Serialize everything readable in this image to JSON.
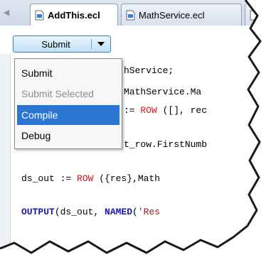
{
  "tabs": [
    {
      "label": "AddThis.ecl",
      "active": true,
      "icon": "ecl-file-icon"
    },
    {
      "label": "MathService.ecl",
      "active": false,
      "icon": "ecl-file-icon"
    }
  ],
  "toolbar": {
    "submit_label": "Submit",
    "dropdown_icon": "chevron-down-icon"
  },
  "menu": {
    "items": [
      {
        "label": "Submit",
        "state": "normal"
      },
      {
        "label": "Submit Selected",
        "state": "disabled"
      },
      {
        "label": "Compile",
        "state": "highlighted"
      },
      {
        "label": "Debug",
        "state": "normal"
      }
    ]
  },
  "code": {
    "line1_text": "hService;",
    "line2_text": "MathService.Ma",
    "line3_op": ":= ",
    "line3_fn": "ROW",
    "line3_rest": " ([], rec",
    "line4_text": "t_row.FirstNumb",
    "line5_var": "ds_out := ",
    "line5_fn": "ROW",
    "line5_rest": " ({res},Math",
    "line6_kw": "OUTPUT",
    "line6_mid": "(ds_out, ",
    "line6_kw2": "NAMED",
    "line6_paren": "(",
    "line6_str": "'Res"
  },
  "colors": {
    "keyword": "#1a1aa6",
    "function": "#d01818",
    "menu_highlight": "#2a76d2",
    "button_border": "#3c7fb1"
  }
}
